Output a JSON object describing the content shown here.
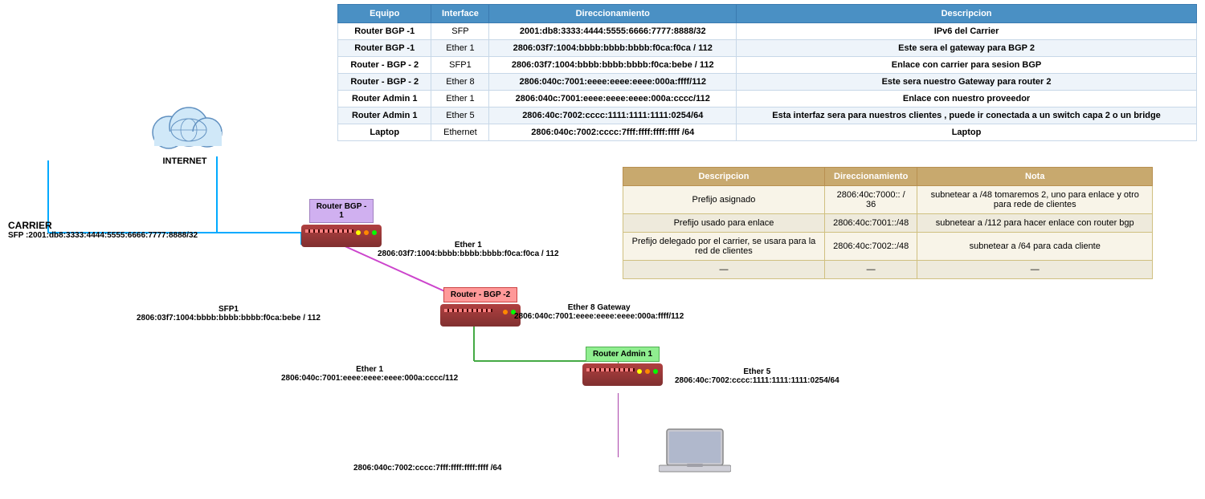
{
  "table": {
    "headers": [
      "Equipo",
      "Interface",
      "Direccionamiento",
      "Descripcion"
    ],
    "rows": [
      [
        "Router BGP -1",
        "SFP",
        "2001:db8:3333:4444:5555:6666:7777:8888/32",
        "IPv6 del Carrier"
      ],
      [
        "Router BGP -1",
        "Ether 1",
        "2806:03f7:1004:bbbb:bbbb:bbbb:f0ca:f0ca / 112",
        "Este sera el gateway para BGP 2"
      ],
      [
        "Router - BGP - 2",
        "SFP1",
        "2806:03f7:1004:bbbb:bbbb:bbbb:f0ca:bebe / 112",
        "Enlace con carrier para sesion BGP"
      ],
      [
        "Router - BGP - 2",
        "Ether 8",
        "2806:040c:7001:eeee:eeee:eeee:000a:ffff/112",
        "Este sera nuestro Gateway para router 2"
      ],
      [
        "Router Admin 1",
        "Ether 1",
        "2806:040c:7001:eeee:eeee:eeee:000a:cccc/112",
        "Enlace con nuestro proveedor"
      ],
      [
        "Router Admin 1",
        "Ether 5",
        "2806:40c:7002:cccc:1111:1111:1111:0254/64",
        "Esta interfaz sera para nuestros clientes , puede ir conectada a un switch capa 2 o un bridge"
      ],
      [
        "Laptop",
        "Ethernet",
        "2806:040c:7002:cccc:7fff:ffff:ffff:ffff /64",
        "Laptop"
      ]
    ]
  },
  "second_table": {
    "headers": [
      "Descripcion",
      "Direccionamiento",
      "Nota"
    ],
    "rows": [
      [
        "Prefijo asignado",
        "2806:40c:7000:: / 36",
        "subnetear a /48  tomaremos 2, uno para enlace y otro para rede de clientes"
      ],
      [
        "Prefijo usado para enlace",
        "2806:40c:7001::/48",
        "subnetear a /112 para hacer enlace con router bgp"
      ],
      [
        "Prefijo delegado por el carrier, se usara para la red de clientes",
        "2806:40c:7002::/48",
        "subnetear a /64 para cada cliente"
      ],
      [
        "—",
        "—",
        "—"
      ]
    ]
  },
  "diagram": {
    "internet_label": "INTERNET",
    "carrier_label": "CARRIER",
    "carrier_sfp": "SFP :2001:db8:3333:4444:5555:6666:7777:8888/32",
    "router_bgp1_label": "Router BGP -\n1",
    "router_bgp2_label": "Router - BGP -2",
    "router_admin1_label": "Router Admin 1",
    "ether1_label": "Ether 1",
    "ether1_addr": "2806:03f7:1004:bbbb:bbbb:bbbb:f0ca:f0ca / 112",
    "sfp1_label": "SFP1",
    "sfp1_addr": "2806:03f7:1004:bbbb:bbbb:bbbb:f0ca:bebe / 112",
    "ether8_label": "Ether 8 Gateway",
    "ether8_addr": "2806:040c:7001:eeee:eeee:eeee:000a:ffff/112",
    "ether1b_label": "Ether 1",
    "ether1b_addr": "2806:040c:7001:eeee:eeee:eeee:000a:cccc/112",
    "ether5_label": "Ether 5",
    "ether5_addr": "2806:40c:7002:cccc:1111:1111:1111:0254/64",
    "laptop_addr": "2806:040c:7002:cccc:7fff:ffff:ffff:ffff /64",
    "laptop_label": "Laptop"
  },
  "colors": {
    "header_blue": "#4a90c4",
    "header_gold": "#c8a96e",
    "row_even_blue": "#eef4fa",
    "row_even_gold": "#eeeadc",
    "router_bgp1_bg": "#d0b0f0",
    "router_admin1_bg": "#90ee90",
    "line_color": "#00aaff",
    "line_carrier": "#00ccff",
    "line_bgp": "#cc44cc",
    "line_admin": "#44aa44"
  }
}
